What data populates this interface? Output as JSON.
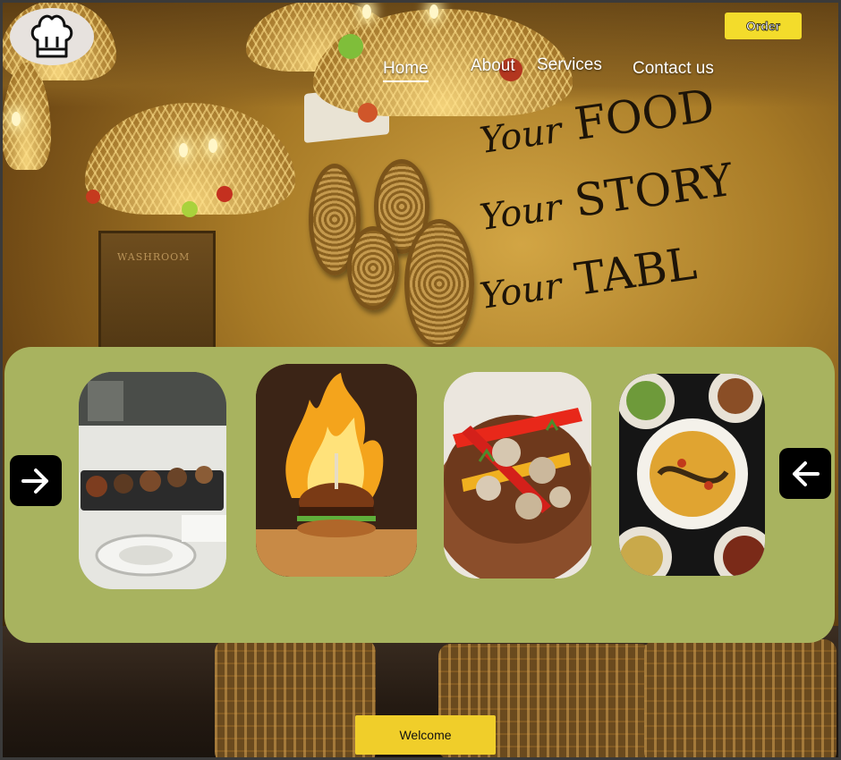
{
  "header": {
    "order_label": "Order"
  },
  "nav": {
    "items": [
      {
        "label": "Home",
        "active": true
      },
      {
        "label": "About",
        "active": false
      },
      {
        "label": "Services",
        "active": false
      },
      {
        "label": "Contact us",
        "active": false
      }
    ]
  },
  "wall": {
    "sign": "WASHROOM",
    "slogan": [
      {
        "your": "Your",
        "word": "FOOD"
      },
      {
        "your": "Your",
        "word": "STORY"
      },
      {
        "your": "Your",
        "word": "TABL"
      }
    ]
  },
  "carousel": {
    "slides": [
      {
        "subject": "restaurant-table-plates"
      },
      {
        "subject": "flaming-burger"
      },
      {
        "subject": "mushroom-pepper-bowl"
      },
      {
        "subject": "noodle-dishes-top-view"
      }
    ],
    "next_icon": "arrow-right-icon",
    "prev_icon": "arrow-left-icon"
  },
  "footer": {
    "welcome_label": "Welcome"
  },
  "colors": {
    "carousel_bg": "#a8b35f",
    "order_button": "#f3dc2b",
    "welcome_button": "#f0ce2a",
    "arrow_button": "#000000"
  }
}
